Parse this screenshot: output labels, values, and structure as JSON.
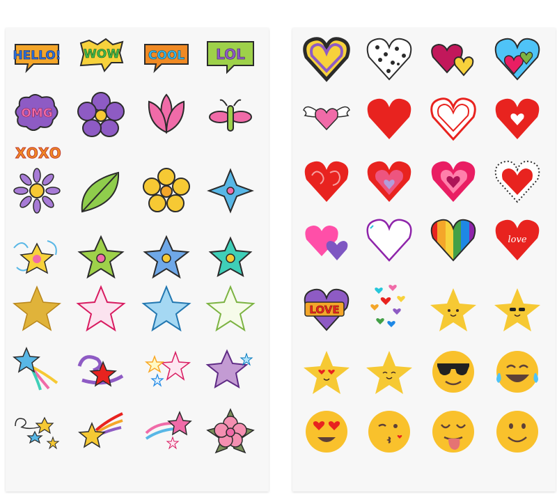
{
  "left_sheet": {
    "word_stickers": [
      "HELLO!",
      "WOW",
      "COOL",
      "LOL",
      "OMG"
    ],
    "xoxo": "XOXO"
  },
  "right_sheet": {
    "love_sticker": "LOVE",
    "love_script": "love"
  },
  "colors": {
    "sheet": "#f7f7f7",
    "heart_red": "#e8231f",
    "emoji_yellow": "#f9c12c",
    "star_yellow": "#f6c934",
    "purple": "#8e5bc4",
    "pink": "#f06ba8"
  }
}
